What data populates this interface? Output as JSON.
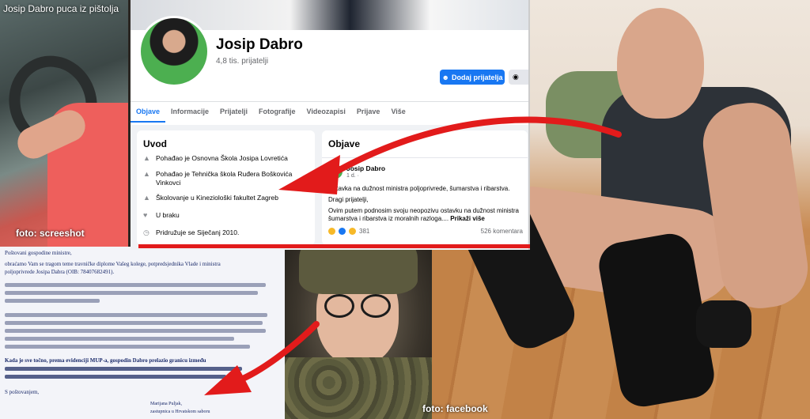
{
  "captions": {
    "top_left": "Josip Dabro puca iz pištolja",
    "car_credit": "foto: screeshot",
    "room_credit": "foto: facebook"
  },
  "facebook": {
    "name": "Josip Dabro",
    "friends": "4,8 tis. prijatelji",
    "add_friend_label": "Dodaj prijatelja",
    "tabs": [
      "Objave",
      "Informacije",
      "Prijatelji",
      "Fotografije",
      "Videozapisi",
      "Prijave",
      "Više"
    ],
    "intro": {
      "title": "Uvod",
      "items": [
        "Pohađao je Osnovna Škola Josipa Lovretića",
        "Pohađao je Tehnička škola Ruđera Boškovića Vinkovci",
        "Školovanje u Kineziološki fakultet Zagreb",
        "U braku",
        "Pridružuje se Siječanj 2010."
      ]
    },
    "posts": {
      "title": "Objave",
      "author": "Josip Dabro",
      "time": "1 d. ·",
      "line1": "Ostavka na dužnost ministra poljoprivrede, šumarstva i ribarstva.",
      "line2": "Dragi prijatelji,",
      "line3": "Ovim putem podnosim svoju neopozivu ostavku na dužnost ministra",
      "line4": "šumarstva i ribarstva iz moralnih razloga....",
      "more": "Prikaži više",
      "reactions": "381",
      "comments": "526 komentara"
    }
  },
  "document": {
    "lines": [
      "Poštovani gospodine ministre,",
      "obraćamo Vam se tragom teme travničke diplome Vašeg kolege, potpredsjednika Vlade i ministra",
      "poljoprivrede Josipa Dabra (OIB: 78407682491).",
      "Kada je sve točno, prema evidenciji MUP-a, gospodin Dabro prelazio granicu između",
      "S poštovanjem,",
      "Marijana Puljak,",
      "zastupnica u Hrvatskom saboru"
    ]
  },
  "colors": {
    "arrow_red": "#e21b1b",
    "fb_blue": "#1877f2"
  }
}
